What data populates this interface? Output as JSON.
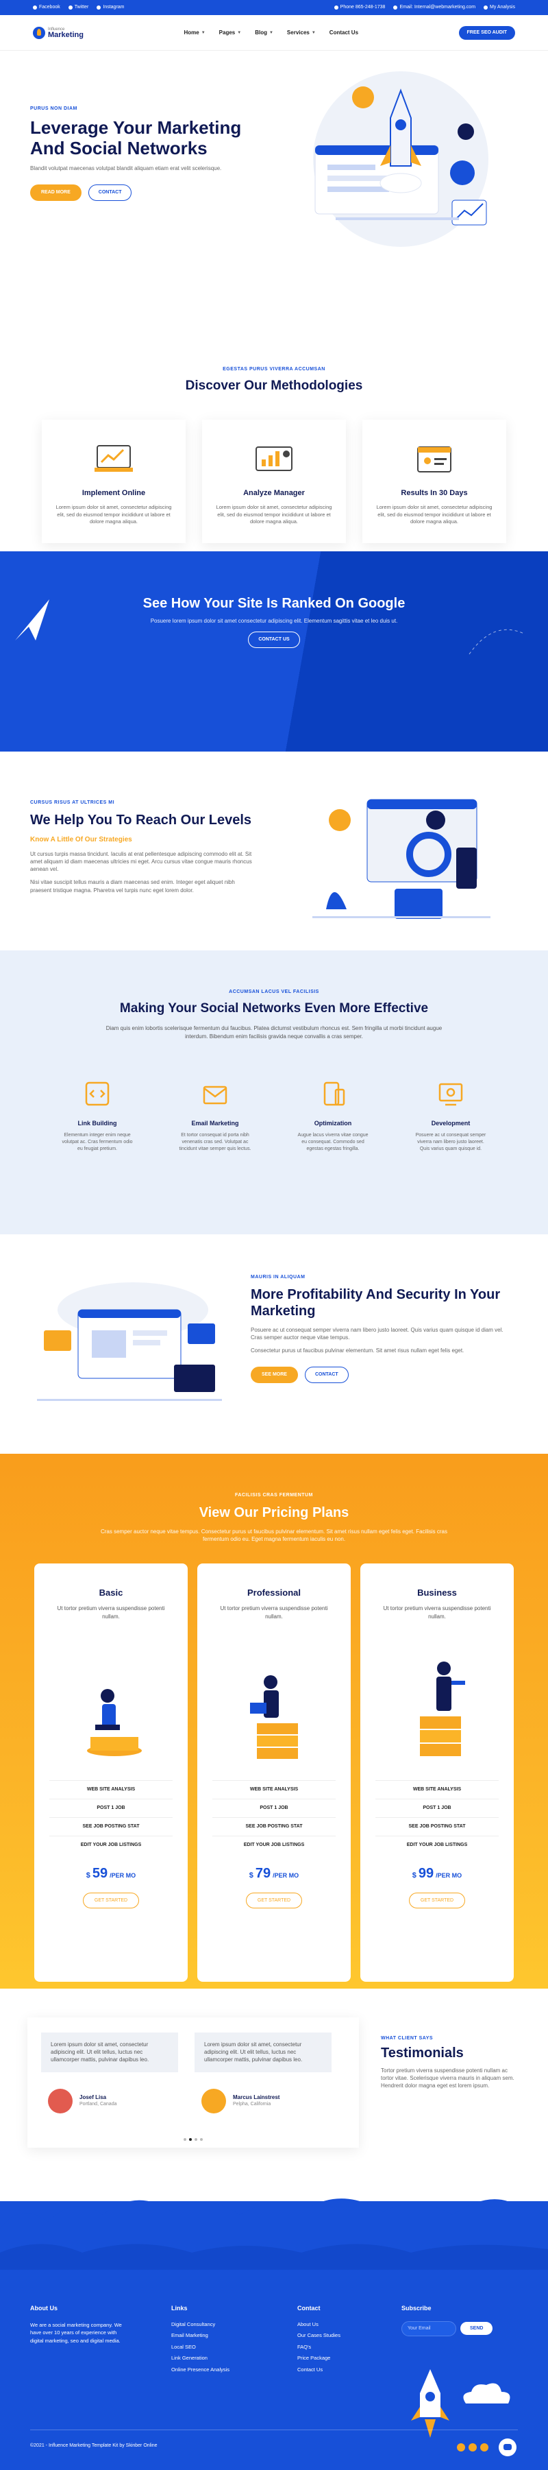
{
  "topbar": {
    "facebook": "Facebook",
    "twitter": "Twitter",
    "instagram": "Instagram",
    "phone": "Phone 865-248-1738",
    "email": "Email: Internal@webmarketing.com",
    "account": "My Analysis"
  },
  "header": {
    "logo_small": "Influence",
    "logo_big": "Marketing",
    "nav": [
      "Home",
      "Pages",
      "Blog",
      "Services",
      "Contact Us"
    ],
    "audit_button": "FREE SEO AUDIT"
  },
  "hero": {
    "kicker": "PURUS NON DIAM",
    "title": "Leverage Your Marketing And Social Networks",
    "text": "Blandit volutpat maecenas volutpat blandit aliquam etiam erat velit scelerisque.",
    "read_more": "READ MORE",
    "contact": "CONTACT"
  },
  "methodologies": {
    "kicker": "EGESTAS PURUS VIVERRA ACCUMSAN",
    "title": "Discover Our Methodologies",
    "cards": [
      {
        "title": "Implement Online",
        "text": "Lorem ipsum dolor sit amet, consectetur adipiscing elit, sed do eiusmod tempor incididunt ut labore et dolore magna aliqua."
      },
      {
        "title": "Analyze Manager",
        "text": "Lorem ipsum dolor sit amet, consectetur adipiscing elit, sed do eiusmod tempor incididunt ut labore et dolore magna aliqua."
      },
      {
        "title": "Results In 30 Days",
        "text": "Lorem ipsum dolor sit amet, consectetur adipiscing elit, sed do eiusmod tempor incididunt ut labore et dolore magna aliqua."
      }
    ]
  },
  "ranked": {
    "title": "See How Your Site Is Ranked On Google",
    "text": "Posuere lorem ipsum dolor sit amet consectetur adipiscing elit. Elementum sagittis vitae et leo duis ut.",
    "button": "CONTACT US"
  },
  "help": {
    "kicker": "CURSUS RISUS AT ULTRICES MI",
    "title": "We Help You To Reach Our Levels",
    "subtitle": "Know A Little Of Our Strategies",
    "p1": "Ut cursus turpis massa tincidunt. Iaculis at erat pellentesque adipiscing commodo elit at. Sit amet aliquam id diam maecenas ultricies mi eget. Arcu cursus vitae congue mauris rhoncus aenean vel.",
    "p2": "Nisi vitae suscipit tellus mauris a diam maecenas sed enim. Integer eget aliquet nibh praesent tristique magna. Pharetra vel turpis nunc eget lorem dolor."
  },
  "social": {
    "kicker": "ACCUMSAN LACUS VEL FACILISIS",
    "title": "Making Your Social Networks Even More Effective",
    "text": "Diam quis enim lobortis scelerisque fermentum dui faucibus. Platea dictumst vestibulum rhoncus est. Sem fringilla ut morbi tincidunt augue interdum. Bibendum enim facilisis gravida neque convallis a cras semper.",
    "items": [
      {
        "title": "Link Building",
        "text": "Elementum integer enim neque volutpat ac. Cras fermentum odio eu feugiat pretium."
      },
      {
        "title": "Email Marketing",
        "text": "Et tortor consequat id porta nibh venenatis cras sed. Volutpat ac tincidunt vitae semper quis lectus."
      },
      {
        "title": "Optimization",
        "text": "Augue lacus viverra vitae congue eu consequat. Commodo sed egestas egestas fringilla."
      },
      {
        "title": "Development",
        "text": "Posuere ac ut consequat semper viverra nam libero justo laoreet. Quis varius quam quisque id."
      }
    ]
  },
  "profit": {
    "kicker": "MAURIS IN ALIQUAM",
    "title": "More Profitability And Security In Your Marketing",
    "p1": "Posuere ac ut consequat semper viverra nam libero justo laoreet. Quis varius quam quisque id diam vel. Cras semper auctor neque vitae tempus.",
    "p2": "Consectetur purus ut faucibus pulvinar elementum. Sit amet risus nullam eget felis eget.",
    "see_more": "SEE MORE",
    "contact": "CONTACT"
  },
  "pricing": {
    "kicker": "FACILISIS CRAS FERMENTUM",
    "title": "View Our Pricing Plans",
    "text": "Cras semper auctor neque vitae tempus. Consectetur purus ut faucibus pulvinar elementum. Sit amet risus nullam eget felis eget. Facilisis cras fermentum odio eu. Eget magna fermentum iaculis eu non.",
    "plans": [
      {
        "name": "Basic",
        "desc": "Ut tortor pretium viverra suspendisse potenti nullam.",
        "features": [
          "WEB SITE ANALYSIS",
          "POST 1 JOB",
          "SEE JOB POSTING STAT",
          "EDIT YOUR JOB LISTINGS"
        ],
        "currency": "$",
        "amount": "59",
        "period": "/PER MO",
        "button": "GET STARTED"
      },
      {
        "name": "Professional",
        "desc": "Ut tortor pretium viverra suspendisse potenti nullam.",
        "features": [
          "WEB SITE ANALYSIS",
          "POST 1 JOB",
          "SEE JOB POSTING STAT",
          "EDIT YOUR JOB LISTINGS"
        ],
        "currency": "$",
        "amount": "79",
        "period": "/PER MO",
        "button": "GET STARTED"
      },
      {
        "name": "Business",
        "desc": "Ut tortor pretium viverra suspendisse potenti nullam.",
        "features": [
          "WEB SITE ANALYSIS",
          "POST 1 JOB",
          "SEE JOB POSTING STAT",
          "EDIT YOUR JOB LISTINGS"
        ],
        "currency": "$",
        "amount": "99",
        "period": "/PER MO",
        "button": "GET STARTED"
      }
    ]
  },
  "testimonials": {
    "kicker": "WHAT CLIENT SAYS",
    "title": "Testimonials",
    "text": "Tortor pretium viverra suspendisse potenti nullam ac tortor vitae. Scelerisque viverra mauris in aliquam sem. Hendrerit dolor magna eget est lorem ipsum.",
    "items": [
      {
        "quote": "Lorem ipsum dolor sit amet, consectetur adipiscing elit. Ut elit tellus, luctus nec ullamcorper mattis, pulvinar dapibus leo.",
        "name": "Josef Lisa",
        "place": "Portland, Canada"
      },
      {
        "quote": "Lorem ipsum dolor sit amet, consectetur adipiscing elit. Ut elit tellus, luctus nec ullamcorper mattis, pulvinar dapibus leo.",
        "name": "Marcus Lainstrest",
        "place": "Pelpha, California"
      }
    ]
  },
  "footer": {
    "about_title": "About Us",
    "about_text": "We are a social marketing company. We have over 10 years of experience with digital marketing, seo and digital media.",
    "links_title": "Links",
    "links": [
      "Digital Consultancy",
      "Email Marketing",
      "Local SEO",
      "Link Generation",
      "Online Presence Analysis"
    ],
    "contact_title": "Contact",
    "contact": [
      "About Us",
      "Our Cases Studies",
      "FAQ's",
      "Price Package",
      "Contact Us"
    ],
    "subscribe_title": "Subscribe",
    "email_placeholder": "Your Email",
    "send": "SEND",
    "copyright": "©2021 - Influence Marketing Template Kit by Skinber Online"
  },
  "colors": {
    "primary": "#1750d8",
    "accent": "#f7a823",
    "navy": "#101a54"
  }
}
